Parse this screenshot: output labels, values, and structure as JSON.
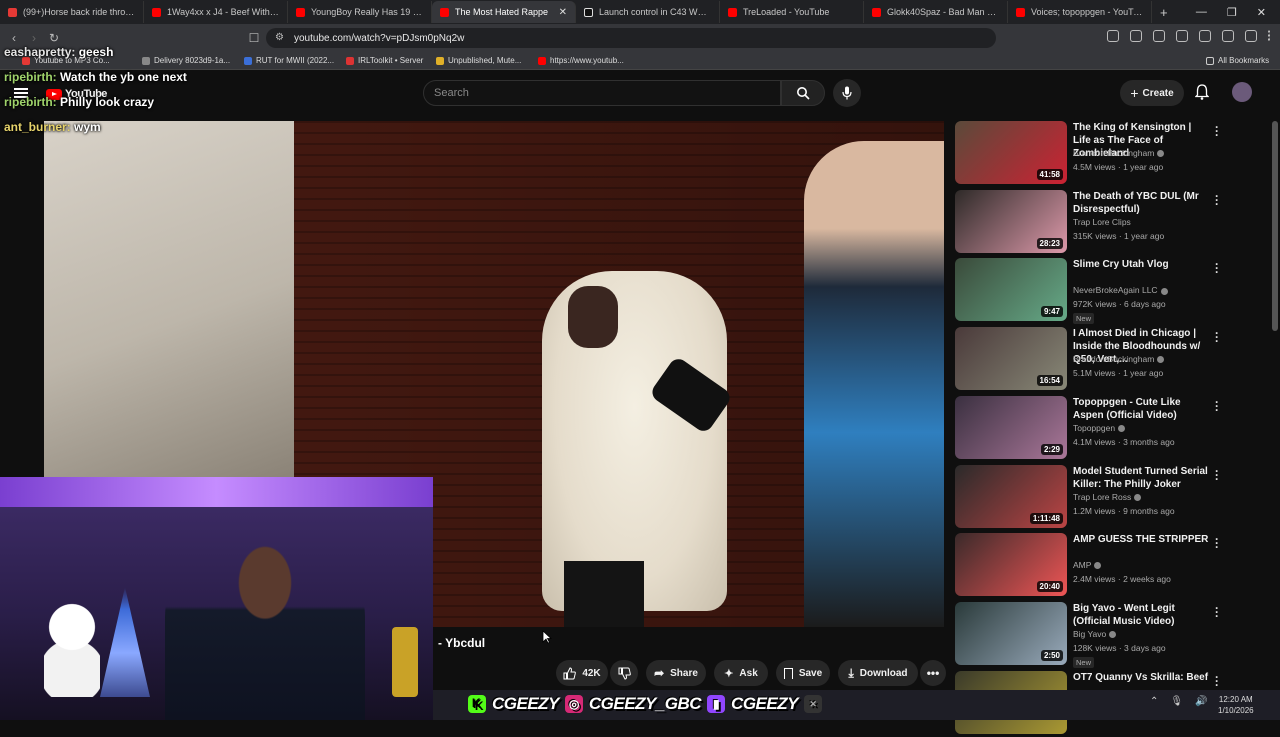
{
  "browser": {
    "tabs": [
      {
        "label": "(99+)Horse back ride through",
        "color": "#e53935"
      },
      {
        "label": "1Way4xx x J4 - Beef With Me",
        "color": "#ff0000"
      },
      {
        "label": "YoungBoy Really Has 19 Bodie",
        "color": "#ff0000"
      },
      {
        "label": "The Most Hated Rappe",
        "color": "#ff0000"
      },
      {
        "label": "Launch control in C43 W206 #",
        "color": "#111111"
      },
      {
        "label": "TreLoaded - YouTube",
        "color": "#ff0000"
      },
      {
        "label": "Glokk40Spaz - Bad Man - YouT",
        "color": "#ff0000"
      },
      {
        "label": "Voices; topoppgen - YouTube",
        "color": "#ff0000"
      }
    ],
    "active_tab_index": 3,
    "url": "youtube.com/watch?v=pDJsm0pNq2w",
    "bookmarks": [
      {
        "label": "Youtube to MP3 Co..."
      },
      {
        "label": "Delivery 8023d9-1a..."
      },
      {
        "label": "RUT for MWII (2022..."
      },
      {
        "label": "IRLToolkit • Server"
      },
      {
        "label": "Unpublished, Mute..."
      },
      {
        "label": "https://www.youtub..."
      },
      {
        "label": "All Bookmarks"
      }
    ]
  },
  "youtube": {
    "logo_text": "YouTube",
    "search_placeholder": "Search",
    "create_label": "Create",
    "video_title_fragment": "- Ybcdul",
    "actions": {
      "likes": "42K",
      "share": "Share",
      "ask": "Ask",
      "save": "Save",
      "download": "Download"
    }
  },
  "chat": [
    {
      "user": "eashapretty:",
      "message": "geesh"
    },
    {
      "user": "ripebirth:",
      "message": "Watch the yb one next"
    },
    {
      "user": "ripebirth:",
      "message": "Philly look crazy"
    },
    {
      "user": "ant_burner:",
      "message": "wym"
    }
  ],
  "recommendations": [
    {
      "title": "The King of Kensington | Life as The Face of Zombieland",
      "channel": "Brandon Buckingham",
      "verified": true,
      "meta": "4.5M views · 1 year ago",
      "duration": "41:58",
      "new": false
    },
    {
      "title": "The Death of YBC DUL (Mr Disrespectful)",
      "channel": "Trap Lore Clips",
      "verified": false,
      "meta": "315K views · 1 year ago",
      "duration": "28:23",
      "new": false
    },
    {
      "title": "Slime Cry Utah Vlog",
      "channel": "NeverBrokeAgain LLC",
      "verified": true,
      "meta": "972K views · 6 days ago",
      "duration": "9:47",
      "new": true
    },
    {
      "title": "I Almost Died in Chicago | Inside the Bloodhounds w/ Q50, Vert,...",
      "channel": "Brandon Buckingham",
      "verified": true,
      "meta": "5.1M views · 1 year ago",
      "duration": "16:54",
      "new": false
    },
    {
      "title": "Topoppgen - Cute Like Aspen (Official Video)",
      "channel": "Topoppgen",
      "verified": true,
      "meta": "4.1M views · 3 months ago",
      "duration": "2:29",
      "new": false
    },
    {
      "title": "Model Student Turned Serial Killer: The Philly Joker",
      "channel": "Trap Lore Ross",
      "verified": true,
      "meta": "1.2M views · 9 months ago",
      "duration": "1:11:48",
      "new": false
    },
    {
      "title": "AMP GUESS THE STRIPPER",
      "channel": "AMP",
      "verified": true,
      "meta": "2.4M views · 2 weeks ago",
      "duration": "20:40",
      "new": false
    },
    {
      "title": "Big Yavo - Went Legit (Official Music Video)",
      "channel": "Big Yavo",
      "verified": true,
      "meta": "128K views · 3 days ago",
      "duration": "2:50",
      "new": true
    },
    {
      "title": "OT7 Quanny Vs Skrilla: Beef",
      "channel": "",
      "verified": false,
      "meta": "",
      "duration": "",
      "new": false
    }
  ],
  "new_badge": "New",
  "overlay_socials": [
    "CGEEZY",
    "CGEEZY_GBC",
    "CGEEZY"
  ],
  "clock": {
    "time": "12:20 AM",
    "date": "1/10/2026"
  }
}
